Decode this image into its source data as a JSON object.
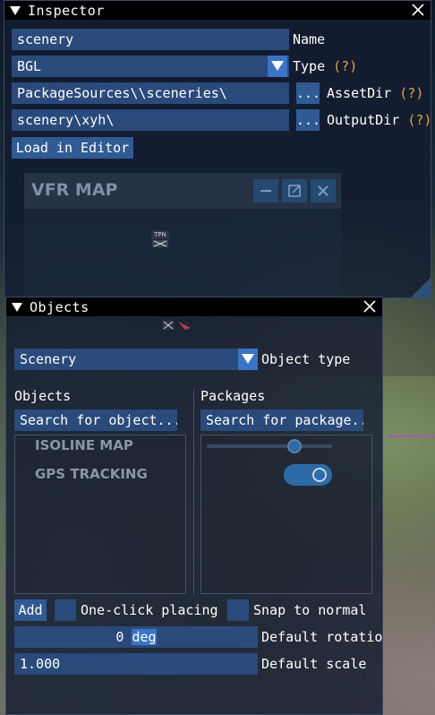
{
  "inspector": {
    "title": "Inspector",
    "name_value": "scenery",
    "name_label": "Name",
    "type_value": "BGL",
    "type_label": "Type",
    "help_marker": "(?)",
    "asset_dir_value": "PackageSources\\\\sceneries\\",
    "asset_dir_label": "AssetDir",
    "output_dir_value": "scenery\\xyh\\",
    "output_dir_label": "OutputDir",
    "browse_label": "...",
    "load_button": "Load in Editor"
  },
  "vfr_map": {
    "title": "VFR MAP",
    "marker_label": "TPN",
    "overlay_items": [
      "ISOLINE MAP",
      "GPS TRACKING"
    ]
  },
  "objects": {
    "title": "Objects",
    "object_type_value": "Scenery",
    "object_type_label": "Object type",
    "objects_header": "Objects",
    "packages_header": "Packages",
    "objects_search": "Search for object...",
    "packages_search": "Search for package..",
    "add_button": "Add",
    "one_click_label": "One-click placing",
    "snap_label": "Snap to normal",
    "rotation_value_num": "0",
    "rotation_value_unit": "deg",
    "rotation_label": "Default rotatio",
    "scale_value": "1.000",
    "scale_label": "Default scale"
  },
  "colors": {
    "field_bg": "#294a7a",
    "button_bg": "#2f5a94",
    "help_text": "#f0a030",
    "titlebar_bg": "#000000"
  }
}
